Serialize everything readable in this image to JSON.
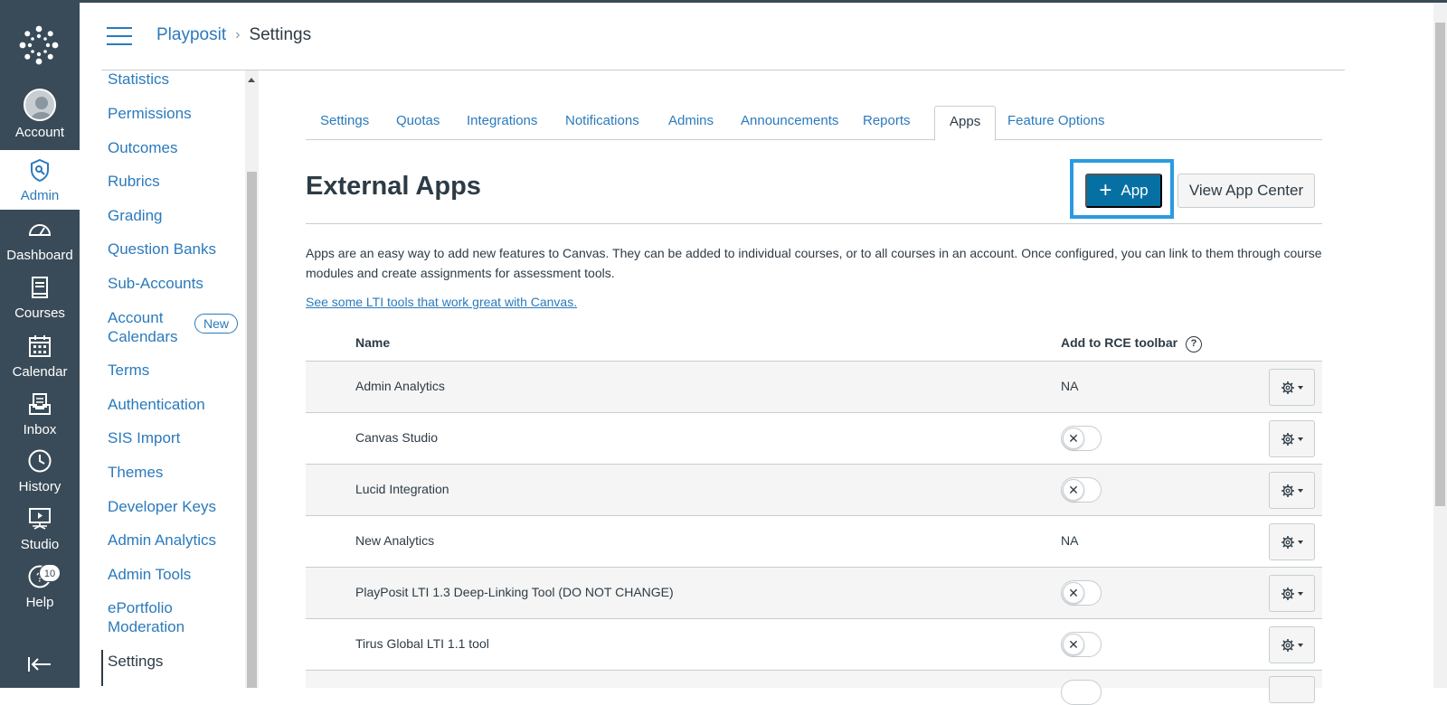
{
  "global_nav": {
    "items": [
      {
        "label": "Account",
        "icon": "avatar"
      },
      {
        "label": "Admin",
        "icon": "admin-shield-icon"
      },
      {
        "label": "Dashboard",
        "icon": "dashboard-icon"
      },
      {
        "label": "Courses",
        "icon": "courses-icon"
      },
      {
        "label": "Calendar",
        "icon": "calendar-icon"
      },
      {
        "label": "Inbox",
        "icon": "inbox-icon"
      },
      {
        "label": "History",
        "icon": "history-icon"
      },
      {
        "label": "Studio",
        "icon": "studio-icon"
      },
      {
        "label": "Help",
        "icon": "help-icon"
      }
    ],
    "help_badge": "10"
  },
  "breadcrumb": {
    "account": "Playposit",
    "current": "Settings"
  },
  "subnav": {
    "items": [
      "Statistics",
      "Permissions",
      "Outcomes",
      "Rubrics",
      "Grading",
      "Question Banks",
      "Sub-Accounts",
      "Account Calendars",
      "Terms",
      "Authentication",
      "SIS Import",
      "Themes",
      "Developer Keys",
      "Admin Analytics",
      "Admin Tools",
      "ePortfolio Moderation",
      "Settings"
    ],
    "new_badge": "New"
  },
  "tabs": [
    "Settings",
    "Quotas",
    "Integrations",
    "Notifications",
    "Admins",
    "Announcements",
    "Reports",
    "Apps",
    "Feature Options"
  ],
  "page": {
    "title": "External Apps",
    "add_app_label": "App",
    "view_app_center_label": "View App Center",
    "description": "Apps are an easy way to add new features to Canvas. They can be added to individual courses, or to all courses in an account. Once configured, you can link to them through course modules and create assignments for assessment tools.",
    "lti_link": "See some LTI tools that work great with Canvas."
  },
  "table": {
    "headers": {
      "name": "Name",
      "rce": "Add to RCE toolbar"
    },
    "rows": [
      {
        "name": "Admin Analytics",
        "rce": "NA"
      },
      {
        "name": "Canvas Studio",
        "rce": "toggle-off"
      },
      {
        "name": "Lucid Integration",
        "rce": "toggle-off"
      },
      {
        "name": "New Analytics",
        "rce": "NA"
      },
      {
        "name": "PlayPosit LTI 1.3 Deep-Linking Tool (DO NOT CHANGE)",
        "rce": "toggle-off"
      },
      {
        "name": "Tirus Global LTI 1.1 tool",
        "rce": "toggle-off"
      }
    ]
  },
  "colors": {
    "nav_bg": "#394b58",
    "link": "#2b7abc",
    "primary_button": "#0770a3",
    "focus_ring": "#2b9ae2"
  }
}
